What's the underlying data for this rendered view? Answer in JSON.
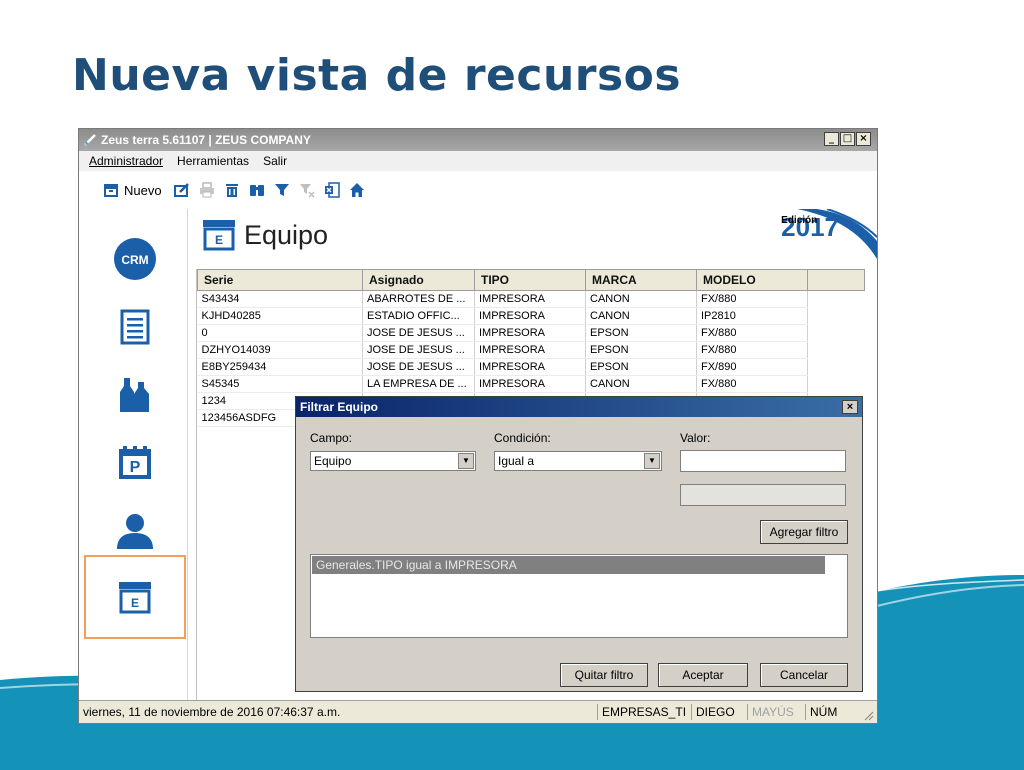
{
  "slide": {
    "title": "Nueva vista de recursos"
  },
  "window": {
    "title": "Zeus terra 5.61107 | ZEUS COMPANY",
    "buttons": {
      "minimize": "_",
      "maximize": "□",
      "close": "×"
    }
  },
  "menu": [
    "Administrador",
    "Herramientas",
    "Salir"
  ],
  "toolbar": {
    "new_label": "Nuevo",
    "icons": [
      "edit-icon",
      "print-icon",
      "delete-icon",
      "find-icon",
      "filter-icon",
      "clear-filter-icon",
      "excel-icon",
      "home-icon"
    ]
  },
  "sidebar": {
    "items": [
      {
        "name": "crm",
        "label": "CRM"
      },
      {
        "name": "list"
      },
      {
        "name": "products"
      },
      {
        "name": "calendar",
        "label": "P"
      },
      {
        "name": "user"
      },
      {
        "name": "equipo",
        "label": "E"
      }
    ]
  },
  "main": {
    "title": "Equipo",
    "title_icon_letter": "E",
    "edicion_label": "Edición",
    "edicion_year": "2017"
  },
  "table": {
    "columns": [
      "Serie",
      "Asignado",
      "TIPO",
      "MARCA",
      "MODELO"
    ],
    "rows": [
      [
        "S43434",
        "ABARROTES DE ...",
        "IMPRESORA",
        "CANON",
        "FX/880"
      ],
      [
        "KJHD40285",
        "ESTADIO OFFIC...",
        "IMPRESORA",
        "CANON",
        "IP2810"
      ],
      [
        "0",
        "JOSE DE JESUS ...",
        "IMPRESORA",
        "EPSON",
        "FX/880"
      ],
      [
        "DZHYO14039",
        "JOSE DE JESUS ...",
        "IMPRESORA",
        "EPSON",
        "FX/880"
      ],
      [
        "E8BY259434",
        "JOSE DE JESUS ...",
        "IMPRESORA",
        "EPSON",
        "FX/890"
      ],
      [
        "S45345",
        "LA EMPRESA DE ...",
        "IMPRESORA",
        "CANON",
        "FX/880"
      ],
      [
        "1234",
        "",
        "",
        "",
        ""
      ],
      [
        "123456ASDFG",
        "",
        "",
        "",
        ""
      ]
    ]
  },
  "dialog": {
    "title": "Filtrar Equipo",
    "close": "×",
    "campo_label": "Campo:",
    "campo_value": "Equipo",
    "condicion_label": "Condición:",
    "condicion_value": "Igual a",
    "valor_label": "Valor:",
    "valor_value": "",
    "add_filter": "Agregar filtro",
    "filters": [
      "Generales.TIPO igual a IMPRESORA"
    ],
    "remove_filter": "Quitar filtro",
    "accept": "Aceptar",
    "cancel": "Cancelar"
  },
  "status": {
    "datetime": "viernes, 11 de noviembre de 2016 07:46:37 a.m.",
    "company": "EMPRESAS_TI",
    "user": "DIEGO",
    "caps": "MAYÚS",
    "num": "NÚM"
  },
  "colors": {
    "title_blue": "#1f4e79",
    "icon_blue": "#1a5fa8",
    "active_border": "#f0a058",
    "dialog_title": "#0a246a",
    "wave": "#1592b8"
  }
}
